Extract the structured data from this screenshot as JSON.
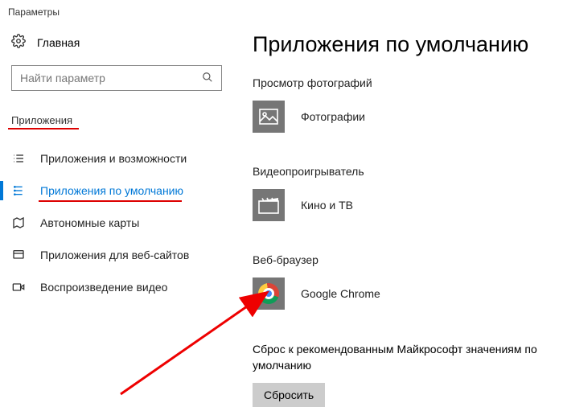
{
  "window": {
    "title": "Параметры"
  },
  "sidebar": {
    "home_label": "Главная",
    "search_placeholder": "Найти параметр",
    "category_title": "Приложения",
    "items": [
      {
        "label": "Приложения и возможности"
      },
      {
        "label": "Приложения по умолчанию"
      },
      {
        "label": "Автономные карты"
      },
      {
        "label": "Приложения для веб-сайтов"
      },
      {
        "label": "Воспроизведение видео"
      }
    ]
  },
  "main": {
    "heading": "Приложения по умолчанию",
    "sections": {
      "photo": {
        "title": "Просмотр фотографий",
        "app": "Фотографии"
      },
      "video": {
        "title": "Видеопроигрыватель",
        "app": "Кино и ТВ"
      },
      "browser": {
        "title": "Веб-браузер",
        "app": "Google Chrome"
      }
    },
    "reset": {
      "text": "Сброс к рекомендованным Майкрософт значениям по умолчанию",
      "button": "Сбросить"
    }
  }
}
